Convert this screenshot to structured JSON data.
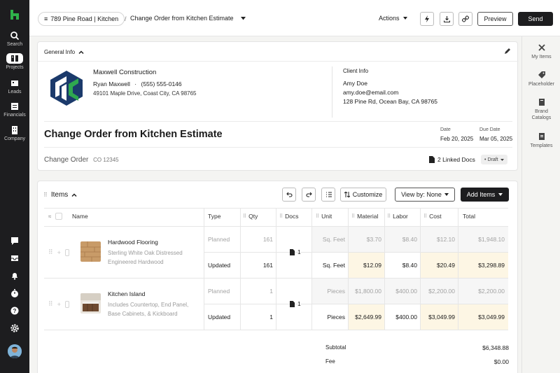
{
  "nav": {
    "items": [
      {
        "label": "Search",
        "icon": "search-icon"
      },
      {
        "label": "Projects",
        "icon": "projects-icon"
      },
      {
        "label": "Leads",
        "icon": "leads-icon"
      },
      {
        "label": "Financials",
        "icon": "financials-icon"
      },
      {
        "label": "Company",
        "icon": "company-icon"
      }
    ]
  },
  "header": {
    "project": "789 Pine Road | Kitchen",
    "separator": "/",
    "document_title": "Change Order from Kitchen Estimate",
    "actions_label": "Actions",
    "preview_label": "Preview",
    "send_label": "Send"
  },
  "right_panel": {
    "items": [
      {
        "label": "My Items"
      },
      {
        "label": "Placeholder"
      },
      {
        "label": "Brand Catalogs"
      },
      {
        "label": "Templates"
      }
    ]
  },
  "general_info": {
    "heading": "General Info",
    "company_name": "Maxwell Construction",
    "contact_name": "Ryan Maxwell",
    "contact_sep": "·",
    "contact_phone": "(555) 555-0146",
    "company_address": "49101 Maple Drive, Coast City, CA 98765",
    "client_label": "Client Info",
    "client_name": "Amy Doe",
    "client_email": "amy.doe@email.com",
    "client_address": "128 Pine Rd, Ocean Bay, CA 98765",
    "title": "Change Order from Kitchen Estimate",
    "date_label": "Date",
    "date_value": "Feb 20, 2025",
    "due_label": "Due Date",
    "due_value": "Mar 05, 2025",
    "co_label": "Change Order",
    "co_number": "CO 12345",
    "linked_docs": "2 Linked Docs",
    "status": "Draft"
  },
  "items": {
    "heading": "Items",
    "customize_label": "Customize",
    "view_by_label": "View by: None",
    "add_items_label": "Add Items",
    "columns": [
      "Name",
      "Type",
      "Qty",
      "Docs",
      "Unit",
      "Material",
      "Labor",
      "Cost",
      "Total"
    ],
    "rows": [
      {
        "name": "Hardwood Flooring",
        "desc1": "Sterling White Oak Distressed",
        "desc2": "Engineered Hardwood",
        "docs": "1",
        "planned": {
          "type": "Planned",
          "qty": "161",
          "unit": "Sq. Feet",
          "material": "$3.70",
          "labor": "$8.40",
          "cost": "$12.10",
          "total": "$1,948.10"
        },
        "updated": {
          "type": "Updated",
          "qty": "161",
          "unit": "Sq. Feet",
          "material": "$12.09",
          "labor": "$8.40",
          "cost": "$20.49",
          "total": "$3,298.89"
        }
      },
      {
        "name": "Kitchen Island",
        "desc1": "Includes Countertop, End Panel,",
        "desc2": "Base Cabinets, & Kickboard",
        "docs": "1",
        "planned": {
          "type": "Planned",
          "qty": "1",
          "unit": "Pieces",
          "material": "$1,800.00",
          "labor": "$400.00",
          "cost": "$2,200.00",
          "total": "$2,200.00"
        },
        "updated": {
          "type": "Updated",
          "qty": "1",
          "unit": "Pieces",
          "material": "$2,649.99",
          "labor": "$400.00",
          "cost": "$3,049.99",
          "total": "$3,049.99"
        }
      }
    ],
    "subtotal_label": "Subtotal",
    "subtotal_value": "$6,348.88",
    "fee_label": "Fee",
    "fee_value": "$0.00"
  },
  "colors": {
    "accent": "#2fb34a",
    "dark": "#1d1d1f",
    "highlight": "#fdf6e4",
    "logo_blue": "#1b3a6b",
    "logo_green": "#2fa84f"
  }
}
